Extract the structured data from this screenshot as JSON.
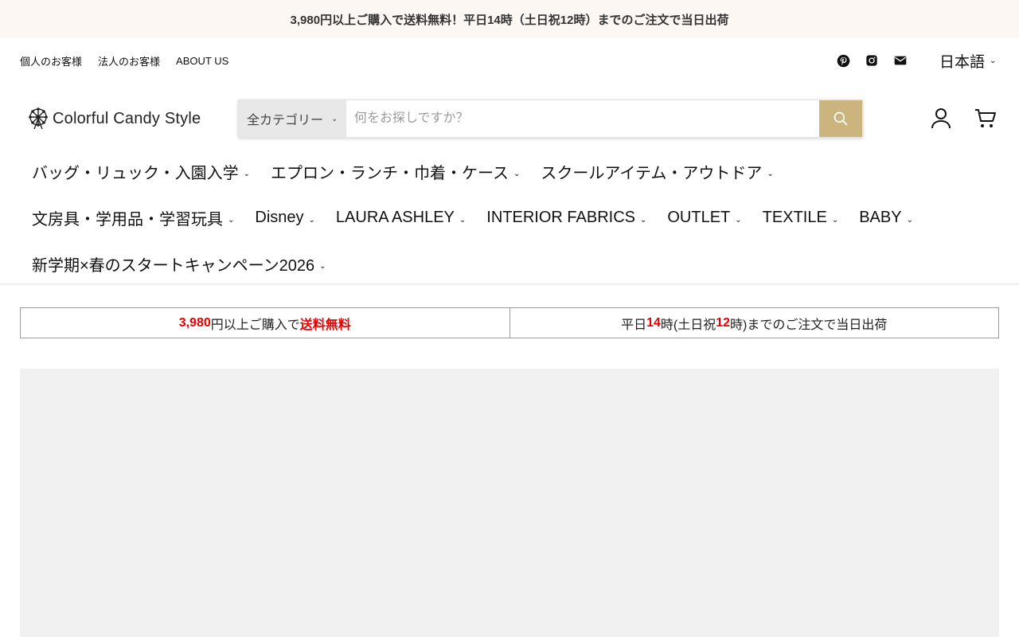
{
  "announcement": "3,980円以上ご購入で送料無料！平日14時（土日祝12時）までのご注文で当日出荷",
  "utility_links": [
    "個人のお客様",
    "法人のお客様",
    "ABOUT US"
  ],
  "social_icons": [
    "pinterest-icon",
    "instagram-icon",
    "email-icon"
  ],
  "language": "日本語",
  "logo_text": "Colorful Candy Style",
  "search": {
    "category": "全カテゴリー",
    "placeholder": "何をお探しですか？"
  },
  "header_icons": [
    "account-icon",
    "cart-icon"
  ],
  "nav": {
    "row1": [
      "バッグ・リュック・入園入学",
      "エプロン・ランチ・巾着・ケース",
      "スクールアイテム・アウトドア"
    ],
    "row2": [
      "文房具・学用品・学習玩具",
      "Disney",
      "LAURA ASHLEY",
      "INTERIOR FABRICS",
      "OUTLET",
      "TEXTILE",
      "BABY"
    ],
    "row3": [
      "新学期×春のスタートキャンペーン2026"
    ]
  },
  "promo": {
    "left": {
      "amount": "3,980",
      "mid": "円以上ご購入で",
      "highlight": "送料無料"
    },
    "right": {
      "pre": "平日",
      "hour1": "14",
      "mid": "時(土日祝",
      "hour2": "12",
      "post": "時)までのご注文で当日出荷"
    }
  },
  "colors": {
    "accent": "#cbb47e",
    "highlight": "#e60000",
    "announce_bg": "#fdf7f3",
    "hero_bg": "#f1f1f1"
  }
}
